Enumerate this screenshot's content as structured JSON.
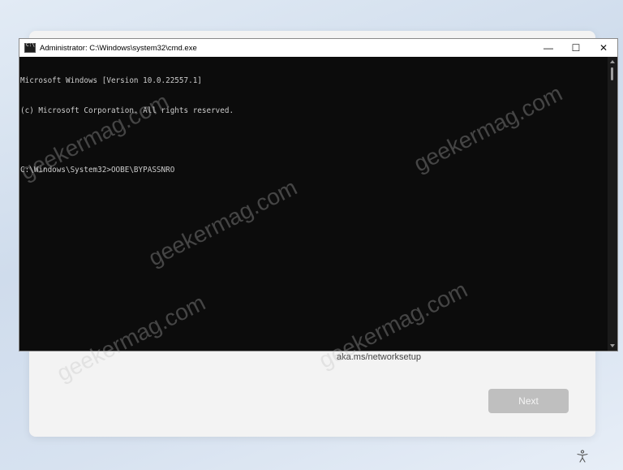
{
  "cmd_window": {
    "title": "Administrator: C:\\Windows\\system32\\cmd.exe",
    "controls": {
      "minimize": "—",
      "maximize": "☐",
      "close": "✕"
    },
    "console_lines": [
      "Microsoft Windows [Version 10.0.22557.1]",
      "(c) Microsoft Corporation. All rights reserved.",
      "",
      "C:\\Windows\\System32>OOBE\\BYPASSNRO"
    ]
  },
  "oobe": {
    "link_text": "aka.ms/networksetup",
    "next_label": "Next"
  },
  "watermark": {
    "text": "geekermag.com"
  },
  "icons": {
    "accessibility": "accessibility-icon",
    "cmd": "cmd-app-icon"
  }
}
